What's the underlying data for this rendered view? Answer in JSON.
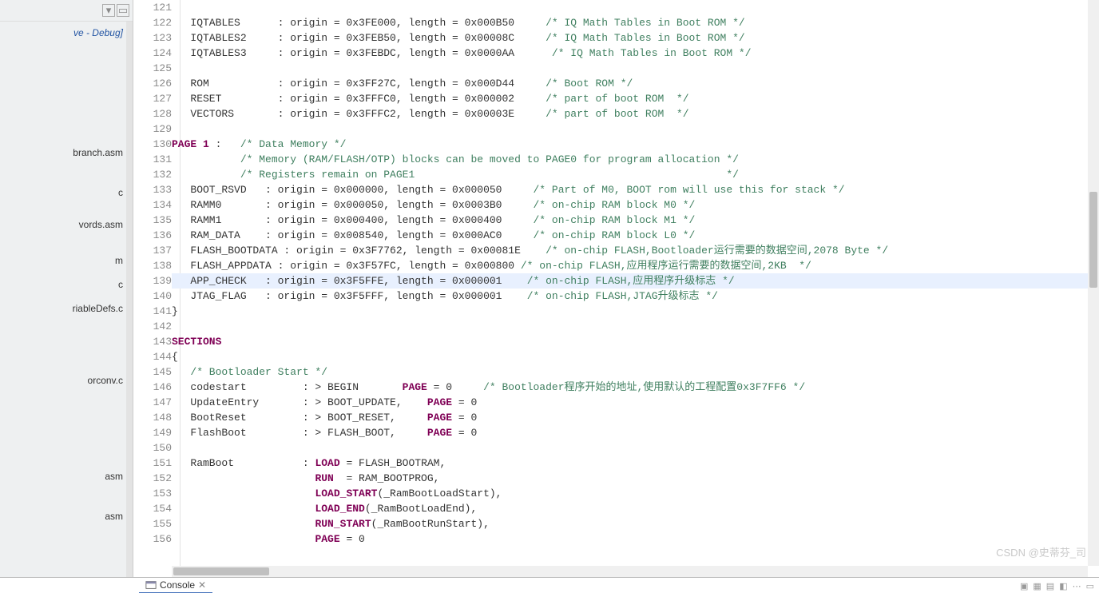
{
  "sidebar": {
    "project_title": "ve - Debug]",
    "files": [
      "branch.asm",
      "c",
      "vords.asm",
      "m",
      "c",
      "riableDefs.c",
      "orconv.c",
      "asm",
      "asm"
    ]
  },
  "editor": {
    "lines": [
      {
        "n": 121,
        "segs": []
      },
      {
        "n": 122,
        "segs": [
          {
            "t": "   IQTABLES      : origin = 0x3FE000, length = 0x000B50     ",
            "c": "txt"
          },
          {
            "t": "/* IQ Math Tables in Boot ROM */",
            "c": "cm"
          }
        ]
      },
      {
        "n": 123,
        "segs": [
          {
            "t": "   IQTABLES2     : origin = 0x3FEB50, length = 0x00008C     ",
            "c": "txt"
          },
          {
            "t": "/* IQ Math Tables in Boot ROM */",
            "c": "cm"
          }
        ]
      },
      {
        "n": 124,
        "segs": [
          {
            "t": "   IQTABLES3     : origin = 0x3FEBDC, length = 0x0000AA      ",
            "c": "txt"
          },
          {
            "t": "/* IQ Math Tables in Boot ROM */",
            "c": "cm"
          }
        ]
      },
      {
        "n": 125,
        "segs": []
      },
      {
        "n": 126,
        "segs": [
          {
            "t": "   ROM           : origin = 0x3FF27C, length = 0x000D44     ",
            "c": "txt"
          },
          {
            "t": "/* Boot ROM */",
            "c": "cm"
          }
        ]
      },
      {
        "n": 127,
        "segs": [
          {
            "t": "   RESET         : origin = 0x3FFFC0, length = 0x000002     ",
            "c": "txt"
          },
          {
            "t": "/* part of boot ROM  */",
            "c": "cm"
          }
        ]
      },
      {
        "n": 128,
        "segs": [
          {
            "t": "   VECTORS       : origin = 0x3FFFC2, length = 0x00003E     ",
            "c": "txt"
          },
          {
            "t": "/* part of boot ROM  */",
            "c": "cm"
          }
        ]
      },
      {
        "n": 129,
        "segs": []
      },
      {
        "n": 130,
        "segs": [
          {
            "t": "PAGE 1",
            "c": "kw"
          },
          {
            "t": " :   ",
            "c": "txt"
          },
          {
            "t": "/* Data Memory */",
            "c": "cm"
          }
        ]
      },
      {
        "n": 131,
        "segs": [
          {
            "t": "           ",
            "c": "txt"
          },
          {
            "t": "/* Memory (RAM/FLASH/OTP) blocks can be moved to PAGE0 for program allocation */",
            "c": "cm"
          }
        ]
      },
      {
        "n": 132,
        "segs": [
          {
            "t": "           ",
            "c": "txt"
          },
          {
            "t": "/* Registers remain on PAGE1                                                  */",
            "c": "cm"
          }
        ]
      },
      {
        "n": 133,
        "segs": [
          {
            "t": "   BOOT_RSVD   : origin = 0x000000, length = 0x000050     ",
            "c": "txt"
          },
          {
            "t": "/* Part of M0, BOOT rom will use this for stack */",
            "c": "cm"
          }
        ]
      },
      {
        "n": 134,
        "segs": [
          {
            "t": "   RAMM0       : origin = 0x000050, length = 0x0003B0     ",
            "c": "txt"
          },
          {
            "t": "/* on-chip RAM block M0 */",
            "c": "cm"
          }
        ]
      },
      {
        "n": 135,
        "segs": [
          {
            "t": "   RAMM1       : origin = 0x000400, length = 0x000400     ",
            "c": "txt"
          },
          {
            "t": "/* on-chip RAM block M1 */",
            "c": "cm"
          }
        ]
      },
      {
        "n": 136,
        "segs": [
          {
            "t": "   RAM_DATA    : origin = 0x008540, length = 0x000AC0     ",
            "c": "txt"
          },
          {
            "t": "/* on-chip RAM block L0 */",
            "c": "cm"
          }
        ]
      },
      {
        "n": 137,
        "segs": [
          {
            "t": "   FLASH_BOOTDATA : origin = 0x3F7762, length = 0x00081E    ",
            "c": "txt"
          },
          {
            "t": "/* on-chip FLASH,Bootloader运行需要的数据空间,2078 Byte */",
            "c": "cm"
          }
        ]
      },
      {
        "n": 138,
        "segs": [
          {
            "t": "   FLASH_APPDATA : origin = 0x3F57FC, length = 0x000800 ",
            "c": "txt"
          },
          {
            "t": "/* on-chip FLASH,应用程序运行需要的数据空间,2KB  */",
            "c": "cm"
          }
        ]
      },
      {
        "n": 139,
        "hl": true,
        "segs": [
          {
            "t": "   APP_CHECK   : origin = 0x3F5FFE, length = 0x000001    ",
            "c": "txt"
          },
          {
            "t": "/* on-chip FLASH,应用程序升级标志 */",
            "c": "cm"
          }
        ]
      },
      {
        "n": 140,
        "segs": [
          {
            "t": "   JTAG_FLAG   : origin = 0x3F5FFF, length = 0x000001    ",
            "c": "txt"
          },
          {
            "t": "/* on-chip FLASH,JTAG升级标志 */",
            "c": "cm"
          }
        ]
      },
      {
        "n": 141,
        "segs": [
          {
            "t": "}",
            "c": "txt"
          }
        ]
      },
      {
        "n": 142,
        "segs": []
      },
      {
        "n": 143,
        "segs": [
          {
            "t": "SECTIONS",
            "c": "kw"
          }
        ]
      },
      {
        "n": 144,
        "segs": [
          {
            "t": "{",
            "c": "txt"
          }
        ]
      },
      {
        "n": 145,
        "segs": [
          {
            "t": "   ",
            "c": "txt"
          },
          {
            "t": "/* Bootloader Start */",
            "c": "cm"
          }
        ]
      },
      {
        "n": 146,
        "segs": [
          {
            "t": "   codestart         : > BEGIN       ",
            "c": "txt"
          },
          {
            "t": "PAGE",
            "c": "pg"
          },
          {
            "t": " = 0     ",
            "c": "txt"
          },
          {
            "t": "/* Bootloader程序开始的地址,使用默认的工程配置0x3F7FF6 */",
            "c": "cm"
          }
        ]
      },
      {
        "n": 147,
        "segs": [
          {
            "t": "   UpdateEntry       : > BOOT_UPDATE,    ",
            "c": "txt"
          },
          {
            "t": "PAGE",
            "c": "pg"
          },
          {
            "t": " = 0",
            "c": "txt"
          }
        ]
      },
      {
        "n": 148,
        "segs": [
          {
            "t": "   BootReset         : > BOOT_RESET,     ",
            "c": "txt"
          },
          {
            "t": "PAGE",
            "c": "pg"
          },
          {
            "t": " = 0",
            "c": "txt"
          }
        ]
      },
      {
        "n": 149,
        "segs": [
          {
            "t": "   FlashBoot         : > FLASH_BOOT,     ",
            "c": "txt"
          },
          {
            "t": "PAGE",
            "c": "pg"
          },
          {
            "t": " = 0",
            "c": "txt"
          }
        ]
      },
      {
        "n": 150,
        "segs": []
      },
      {
        "n": 151,
        "segs": [
          {
            "t": "   RamBoot           : ",
            "c": "txt"
          },
          {
            "t": "LOAD",
            "c": "kw"
          },
          {
            "t": " = FLASH_BOOTRAM,",
            "c": "txt"
          }
        ]
      },
      {
        "n": 152,
        "segs": [
          {
            "t": "                       ",
            "c": "txt"
          },
          {
            "t": "RUN",
            "c": "kw"
          },
          {
            "t": "  = RAM_BOOTPROG,",
            "c": "txt"
          }
        ]
      },
      {
        "n": 153,
        "segs": [
          {
            "t": "                       ",
            "c": "txt"
          },
          {
            "t": "LOAD_START",
            "c": "kw"
          },
          {
            "t": "(_RamBootLoadStart),",
            "c": "txt"
          }
        ]
      },
      {
        "n": 154,
        "segs": [
          {
            "t": "                       ",
            "c": "txt"
          },
          {
            "t": "LOAD_END",
            "c": "kw"
          },
          {
            "t": "(_RamBootLoadEnd),",
            "c": "txt"
          }
        ]
      },
      {
        "n": 155,
        "segs": [
          {
            "t": "                       ",
            "c": "txt"
          },
          {
            "t": "RUN_START",
            "c": "kw"
          },
          {
            "t": "(_RamBootRunStart),",
            "c": "txt"
          }
        ]
      },
      {
        "n": 156,
        "segs": [
          {
            "t": "                       ",
            "c": "txt"
          },
          {
            "t": "PAGE",
            "c": "pg"
          },
          {
            "t": " = 0",
            "c": "txt"
          }
        ]
      }
    ]
  },
  "console": {
    "tab_label": "Console",
    "tab_close": "✕"
  },
  "watermark": "CSDN @史蒂芬_司"
}
